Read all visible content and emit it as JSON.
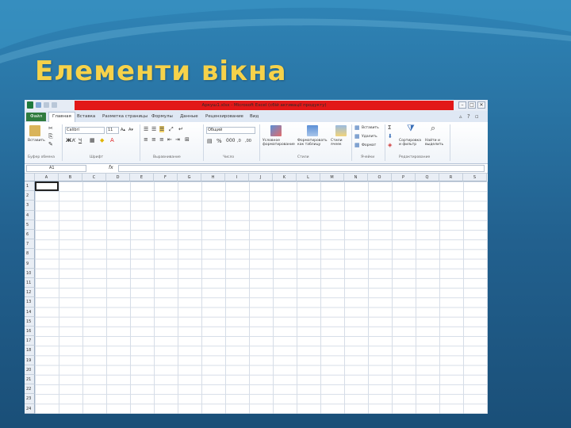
{
  "slide": {
    "title": "Елементи вікна",
    "title_color": "#f6d24a",
    "background_color": "#22618f"
  },
  "excel": {
    "window_title": "Аркуш1.xlsx - Microsoft Excel (сбій активації продукту)",
    "window_buttons": [
      "–",
      "□",
      "✕"
    ],
    "tabs": [
      "Файл",
      "Главная",
      "Вставка",
      "Разметка страницы",
      "Формулы",
      "Данные",
      "Рецензирование",
      "Вид"
    ],
    "active_tab": "Главная",
    "ribbon": {
      "clipboard": {
        "paste_label": "Вставить",
        "group": "Буфер обмена"
      },
      "font": {
        "name": "Calibri",
        "size": "11",
        "bold": "Ж",
        "italic": "К",
        "underline": "Ч",
        "group": "Шрифт"
      },
      "alignment": {
        "group": "Выравнивание"
      },
      "number": {
        "format": "Общий",
        "group": "Число"
      },
      "styles": {
        "conditional": "Условное форматирование",
        "as_table": "Форматировать как таблицу",
        "cell_styles": "Стили ячеек",
        "group": "Стили"
      },
      "cells": {
        "insert": "Вставить",
        "delete": "Удалить",
        "format": "Формат",
        "group": "Ячейки"
      },
      "editing": {
        "sort": "Сортировка и фильтр",
        "find": "Найти и выделить",
        "group": "Редактирование"
      }
    },
    "formula_bar": {
      "name_box": "A1",
      "fx": "fx",
      "value": ""
    },
    "columns": [
      "A",
      "B",
      "C",
      "D",
      "E",
      "F",
      "G",
      "H",
      "I",
      "J",
      "K",
      "L",
      "M",
      "N",
      "O",
      "P",
      "Q",
      "R",
      "S"
    ],
    "rows": [
      "1",
      "2",
      "3",
      "4",
      "5",
      "6",
      "7",
      "8",
      "9",
      "10",
      "11",
      "12",
      "13",
      "14",
      "15",
      "16",
      "17",
      "18",
      "19",
      "20",
      "21",
      "22",
      "23",
      "24"
    ],
    "accent_colors": {
      "file_tab": "#2f7b3f",
      "title_highlight": "#e21818"
    }
  }
}
